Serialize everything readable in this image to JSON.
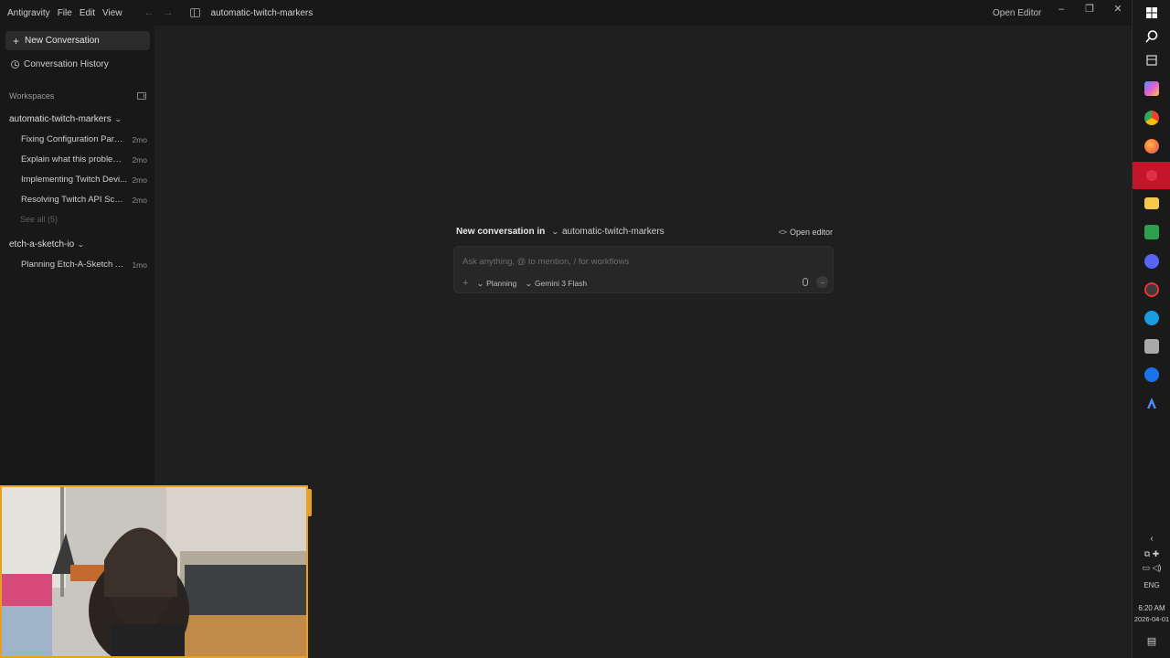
{
  "titlebar": {
    "menu": [
      "Antigravity",
      "File",
      "Edit",
      "View"
    ],
    "workspace": "automatic-twitch-markers",
    "open_editor": "Open Editor"
  },
  "sidebar": {
    "new_conversation": "New Conversation",
    "history": "Conversation History",
    "workspaces_label": "Workspaces",
    "workspaces": [
      {
        "name": "automatic-twitch-markers",
        "conversations": [
          {
            "title": "Fixing Configuration Parse ...",
            "age": "2mo"
          },
          {
            "title": "Explain what this problem i...",
            "age": "2mo"
          },
          {
            "title": "Implementing Twitch Devi...",
            "age": "2mo"
          },
          {
            "title": "Resolving Twitch API Scop...",
            "age": "2mo"
          }
        ],
        "see_all": "See all (5)"
      },
      {
        "name": "etch-a-sketch-io",
        "conversations": [
          {
            "title": "Planning Etch-A-Sketch App",
            "age": "1mo"
          }
        ]
      }
    ]
  },
  "composer": {
    "intro": "New conversation in",
    "workspace": "automatic-twitch-markers",
    "open_editor": "Open editor",
    "placeholder": "Ask anything, @ to mention, / for workflows",
    "mode": "Planning",
    "model": "Gemini 3 Flash"
  },
  "taskbar": {
    "language": "ENG",
    "time": "6:20 AM",
    "date": "2026-04-01",
    "colors": {
      "copilot": "#4f8cff",
      "chrome": "#e94235",
      "firefox": "#ff7139",
      "red_app": "#c4162a",
      "files": "#f2c94c",
      "sheets": "#2e9e4f",
      "discord": "#5865f2",
      "steam": "#1b9be0"
    }
  }
}
